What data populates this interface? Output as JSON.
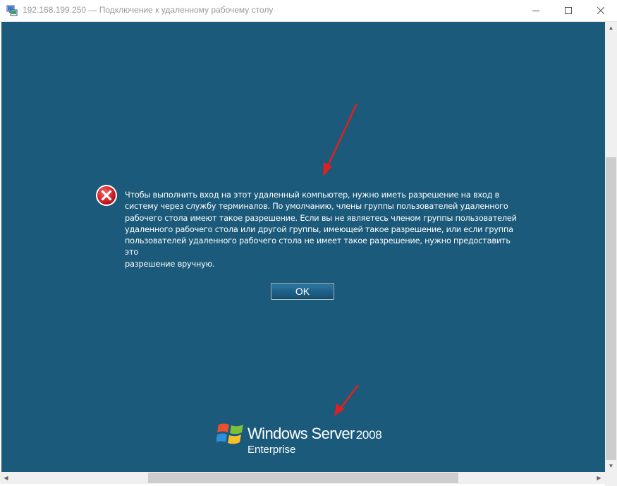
{
  "window": {
    "title": "192.168.199.250 — Подключение к удаленному рабочему столу"
  },
  "colors": {
    "desktop_background": "#1b5a7a",
    "annotation_arrow": "#e02020",
    "error_icon": "#d9252a"
  },
  "icons": {
    "app": "remote-desktop-icon",
    "error": "error-x-icon",
    "minimize": "minimize-icon",
    "maximize": "maximize-icon",
    "close": "close-icon"
  },
  "dialog": {
    "message_lines": [
      "Чтобы выполнить вход на этот удаленный компьютер, нужно иметь разрешение на вход в",
      "систему через службу терминалов. По умолчанию, члены группы пользователей удаленного",
      "рабочего стола имеют такое разрешение. Если вы не являетесь членом группы пользователей",
      "удаленного рабочего стола или другой группы, имеющей такое разрешение, или если группа",
      "пользователей удаленного рабочего стола не имеет такое разрешение, нужно предоставить это",
      "разрешение вручную."
    ],
    "ok_label": "OK"
  },
  "logo": {
    "brand": "Windows Server",
    "version": "2008",
    "edition": "Enterprise"
  },
  "scrollbars": {
    "vertical_position": 0.45,
    "horizontal_position": 0.5
  }
}
